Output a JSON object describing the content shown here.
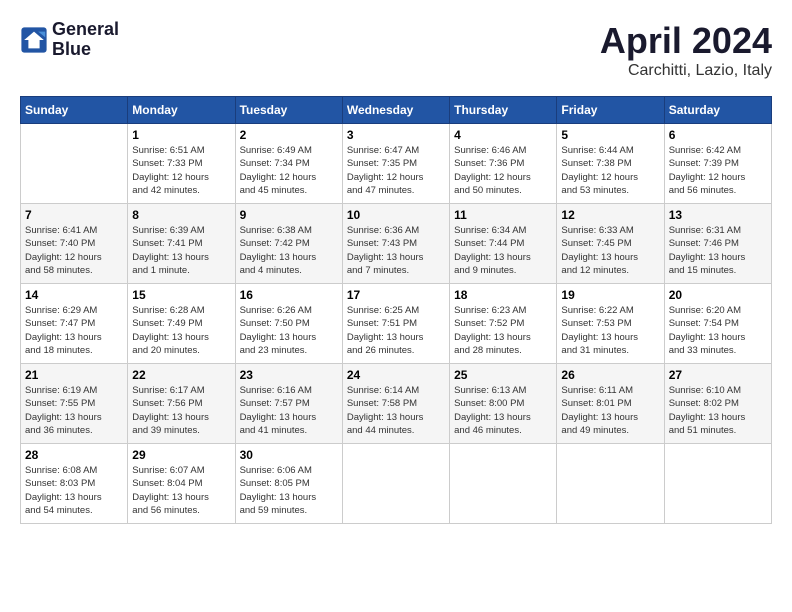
{
  "header": {
    "logo_line1": "General",
    "logo_line2": "Blue",
    "month_title": "April 2024",
    "subtitle": "Carchitti, Lazio, Italy"
  },
  "days_of_week": [
    "Sunday",
    "Monday",
    "Tuesday",
    "Wednesday",
    "Thursday",
    "Friday",
    "Saturday"
  ],
  "weeks": [
    [
      {
        "day": "",
        "info": ""
      },
      {
        "day": "1",
        "info": "Sunrise: 6:51 AM\nSunset: 7:33 PM\nDaylight: 12 hours\nand 42 minutes."
      },
      {
        "day": "2",
        "info": "Sunrise: 6:49 AM\nSunset: 7:34 PM\nDaylight: 12 hours\nand 45 minutes."
      },
      {
        "day": "3",
        "info": "Sunrise: 6:47 AM\nSunset: 7:35 PM\nDaylight: 12 hours\nand 47 minutes."
      },
      {
        "day": "4",
        "info": "Sunrise: 6:46 AM\nSunset: 7:36 PM\nDaylight: 12 hours\nand 50 minutes."
      },
      {
        "day": "5",
        "info": "Sunrise: 6:44 AM\nSunset: 7:38 PM\nDaylight: 12 hours\nand 53 minutes."
      },
      {
        "day": "6",
        "info": "Sunrise: 6:42 AM\nSunset: 7:39 PM\nDaylight: 12 hours\nand 56 minutes."
      }
    ],
    [
      {
        "day": "7",
        "info": "Sunrise: 6:41 AM\nSunset: 7:40 PM\nDaylight: 12 hours\nand 58 minutes."
      },
      {
        "day": "8",
        "info": "Sunrise: 6:39 AM\nSunset: 7:41 PM\nDaylight: 13 hours\nand 1 minute."
      },
      {
        "day": "9",
        "info": "Sunrise: 6:38 AM\nSunset: 7:42 PM\nDaylight: 13 hours\nand 4 minutes."
      },
      {
        "day": "10",
        "info": "Sunrise: 6:36 AM\nSunset: 7:43 PM\nDaylight: 13 hours\nand 7 minutes."
      },
      {
        "day": "11",
        "info": "Sunrise: 6:34 AM\nSunset: 7:44 PM\nDaylight: 13 hours\nand 9 minutes."
      },
      {
        "day": "12",
        "info": "Sunrise: 6:33 AM\nSunset: 7:45 PM\nDaylight: 13 hours\nand 12 minutes."
      },
      {
        "day": "13",
        "info": "Sunrise: 6:31 AM\nSunset: 7:46 PM\nDaylight: 13 hours\nand 15 minutes."
      }
    ],
    [
      {
        "day": "14",
        "info": "Sunrise: 6:29 AM\nSunset: 7:47 PM\nDaylight: 13 hours\nand 18 minutes."
      },
      {
        "day": "15",
        "info": "Sunrise: 6:28 AM\nSunset: 7:49 PM\nDaylight: 13 hours\nand 20 minutes."
      },
      {
        "day": "16",
        "info": "Sunrise: 6:26 AM\nSunset: 7:50 PM\nDaylight: 13 hours\nand 23 minutes."
      },
      {
        "day": "17",
        "info": "Sunrise: 6:25 AM\nSunset: 7:51 PM\nDaylight: 13 hours\nand 26 minutes."
      },
      {
        "day": "18",
        "info": "Sunrise: 6:23 AM\nSunset: 7:52 PM\nDaylight: 13 hours\nand 28 minutes."
      },
      {
        "day": "19",
        "info": "Sunrise: 6:22 AM\nSunset: 7:53 PM\nDaylight: 13 hours\nand 31 minutes."
      },
      {
        "day": "20",
        "info": "Sunrise: 6:20 AM\nSunset: 7:54 PM\nDaylight: 13 hours\nand 33 minutes."
      }
    ],
    [
      {
        "day": "21",
        "info": "Sunrise: 6:19 AM\nSunset: 7:55 PM\nDaylight: 13 hours\nand 36 minutes."
      },
      {
        "day": "22",
        "info": "Sunrise: 6:17 AM\nSunset: 7:56 PM\nDaylight: 13 hours\nand 39 minutes."
      },
      {
        "day": "23",
        "info": "Sunrise: 6:16 AM\nSunset: 7:57 PM\nDaylight: 13 hours\nand 41 minutes."
      },
      {
        "day": "24",
        "info": "Sunrise: 6:14 AM\nSunset: 7:58 PM\nDaylight: 13 hours\nand 44 minutes."
      },
      {
        "day": "25",
        "info": "Sunrise: 6:13 AM\nSunset: 8:00 PM\nDaylight: 13 hours\nand 46 minutes."
      },
      {
        "day": "26",
        "info": "Sunrise: 6:11 AM\nSunset: 8:01 PM\nDaylight: 13 hours\nand 49 minutes."
      },
      {
        "day": "27",
        "info": "Sunrise: 6:10 AM\nSunset: 8:02 PM\nDaylight: 13 hours\nand 51 minutes."
      }
    ],
    [
      {
        "day": "28",
        "info": "Sunrise: 6:08 AM\nSunset: 8:03 PM\nDaylight: 13 hours\nand 54 minutes."
      },
      {
        "day": "29",
        "info": "Sunrise: 6:07 AM\nSunset: 8:04 PM\nDaylight: 13 hours\nand 56 minutes."
      },
      {
        "day": "30",
        "info": "Sunrise: 6:06 AM\nSunset: 8:05 PM\nDaylight: 13 hours\nand 59 minutes."
      },
      {
        "day": "",
        "info": ""
      },
      {
        "day": "",
        "info": ""
      },
      {
        "day": "",
        "info": ""
      },
      {
        "day": "",
        "info": ""
      }
    ]
  ]
}
